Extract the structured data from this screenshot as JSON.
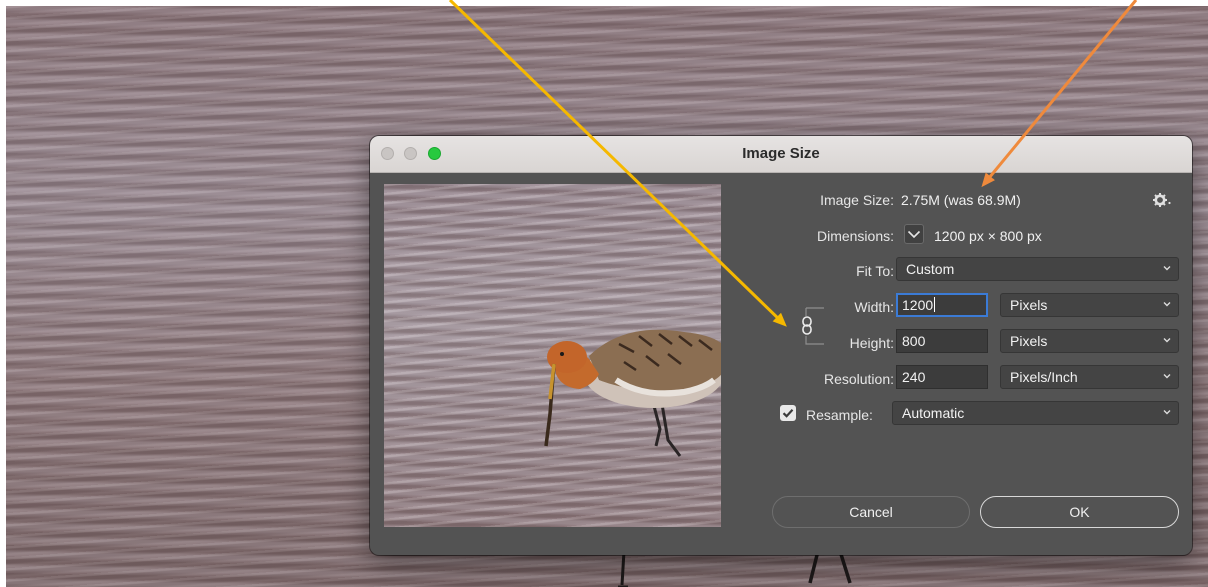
{
  "dialog": {
    "title": "Image Size"
  },
  "image_size": {
    "label": "Image Size:",
    "value": "2.75M (was 68.9M)"
  },
  "dimensions": {
    "label": "Dimensions:",
    "value": "1200 px  ×  800 px"
  },
  "fit_to": {
    "label": "Fit To:",
    "selected": "Custom"
  },
  "width": {
    "label": "Width:",
    "value": "1200",
    "unit": "Pixels"
  },
  "height": {
    "label": "Height:",
    "value": "800",
    "unit": "Pixels"
  },
  "resolution": {
    "label": "Resolution:",
    "value": "240",
    "unit": "Pixels/Inch"
  },
  "resample": {
    "label": "Resample:",
    "checked": true,
    "selected": "Automatic"
  },
  "buttons": {
    "cancel": "Cancel",
    "ok": "OK"
  },
  "colors": {
    "dialog_bg": "#535353",
    "focus_ring": "#3b7bd6",
    "zoom_button": "#27c93f",
    "arrow_yellow": "#f5b800",
    "arrow_orange": "#ef8a3c"
  },
  "icons": {
    "gear": "gear-icon",
    "link": "chain-link-icon",
    "chevron": "chevron-down-icon",
    "checkmark": "checkmark-icon"
  }
}
